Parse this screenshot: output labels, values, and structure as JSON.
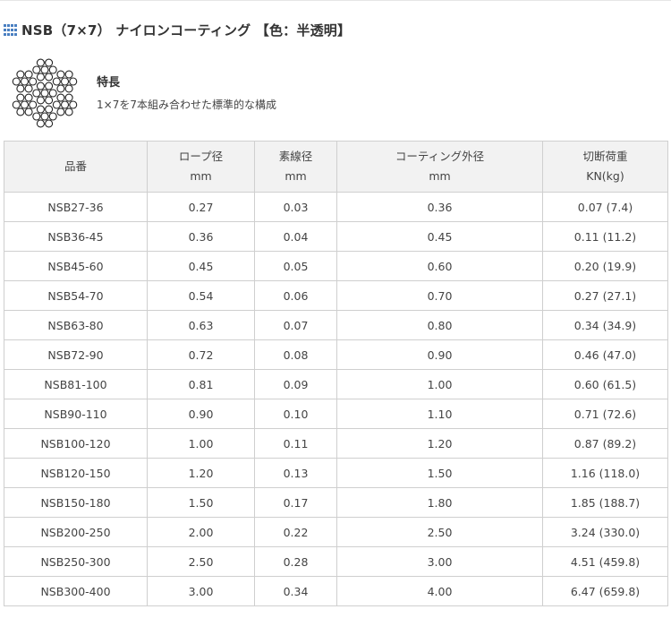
{
  "header": {
    "title": "NSB（7×7） ナイロンコーティング 【色：半透明】",
    "icon": "grid-icon"
  },
  "feature": {
    "title": "特長",
    "description": "1×7を7本組み合わせた標準的な構成",
    "image_icon": "wire-rope-cross-section-icon"
  },
  "table": {
    "headers": [
      {
        "label": "品番",
        "unit": ""
      },
      {
        "label": "ロープ径",
        "unit": "mm"
      },
      {
        "label": "素線径",
        "unit": "mm"
      },
      {
        "label": "コーティング外径",
        "unit": "mm"
      },
      {
        "label": "切断荷重",
        "unit": "KN(kg)"
      }
    ],
    "rows": [
      [
        "NSB27-36",
        "0.27",
        "0.03",
        "0.36",
        "0.07 (7.4)"
      ],
      [
        "NSB36-45",
        "0.36",
        "0.04",
        "0.45",
        "0.11 (11.2)"
      ],
      [
        "NSB45-60",
        "0.45",
        "0.05",
        "0.60",
        "0.20 (19.9)"
      ],
      [
        "NSB54-70",
        "0.54",
        "0.06",
        "0.70",
        "0.27 (27.1)"
      ],
      [
        "NSB63-80",
        "0.63",
        "0.07",
        "0.80",
        "0.34 (34.9)"
      ],
      [
        "NSB72-90",
        "0.72",
        "0.08",
        "0.90",
        "0.46 (47.0)"
      ],
      [
        "NSB81-100",
        "0.81",
        "0.09",
        "1.00",
        "0.60 (61.5)"
      ],
      [
        "NSB90-110",
        "0.90",
        "0.10",
        "1.10",
        "0.71 (72.6)"
      ],
      [
        "NSB100-120",
        "1.00",
        "0.11",
        "1.20",
        "0.87 (89.2)"
      ],
      [
        "NSB120-150",
        "1.20",
        "0.13",
        "1.50",
        "1.16 (118.0)"
      ],
      [
        "NSB150-180",
        "1.50",
        "0.17",
        "1.80",
        "1.85 (188.7)"
      ],
      [
        "NSB200-250",
        "2.00",
        "0.22",
        "2.50",
        "3.24 (330.0)"
      ],
      [
        "NSB250-300",
        "2.50",
        "0.28",
        "3.00",
        "4.51 (459.8)"
      ],
      [
        "NSB300-400",
        "3.00",
        "0.34",
        "4.00",
        "6.47 (659.8)"
      ]
    ]
  },
  "colors": {
    "icon_blue": "#4a7fc1",
    "header_bg": "#f2f2f2",
    "border": "#cfcfcf"
  }
}
